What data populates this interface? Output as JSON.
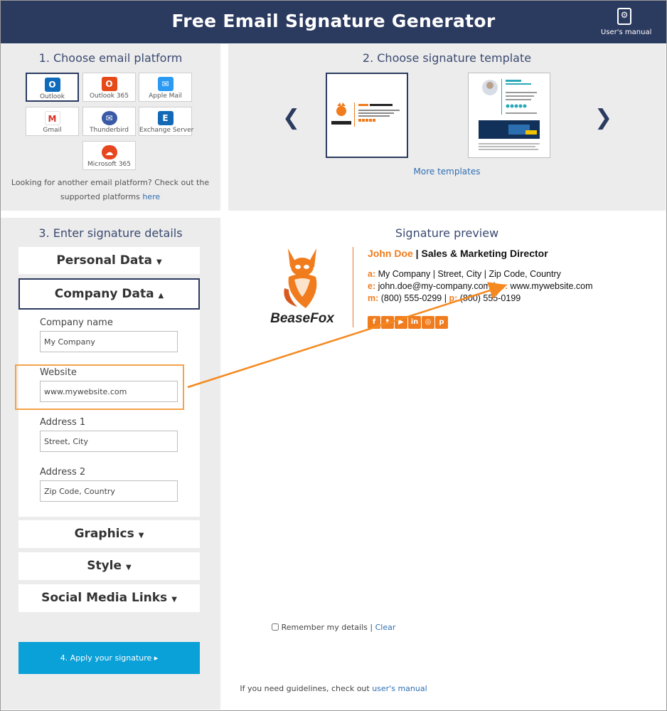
{
  "header": {
    "title": "Free Email Signature Generator",
    "manual_label": "User's manual"
  },
  "step1": {
    "title": "1. Choose email platform",
    "platforms": [
      {
        "label": "Outlook",
        "icon": "outlook-icon",
        "glyph": "O"
      },
      {
        "label": "Outlook 365",
        "icon": "outlook-365-icon",
        "glyph": "O"
      },
      {
        "label": "Apple Mail",
        "icon": "apple-mail-icon",
        "glyph": "✉"
      },
      {
        "label": "Gmail",
        "icon": "gmail-icon",
        "glyph": "M"
      },
      {
        "label": "Thunderbird",
        "icon": "thunderbird-icon",
        "glyph": "✉"
      },
      {
        "label": "Exchange Server",
        "icon": "exchange-icon",
        "glyph": "E"
      },
      {
        "label": "Microsoft 365",
        "icon": "microsoft-365-icon",
        "glyph": "☁"
      }
    ],
    "note": "Looking for another email platform? Check out the supported platforms",
    "note_link": "here"
  },
  "step2": {
    "title": "2. Choose signature template",
    "more_templates": "More templates",
    "prev_glyph": "❮",
    "next_glyph": "❯"
  },
  "step3": {
    "title": "3. Enter signature details",
    "sections": {
      "personal": "Personal Data",
      "company": "Company Data",
      "graphics": "Graphics",
      "style": "Style",
      "social": "Social Media Links"
    },
    "fields": {
      "company_name": {
        "label": "Company name",
        "value": "My Company"
      },
      "website": {
        "label": "Website",
        "value": "www.mywebsite.com"
      },
      "address1": {
        "label": "Address 1",
        "value": "Street, City"
      },
      "address2": {
        "label": "Address 2",
        "value": "Zip Code, Country"
      }
    },
    "remember": "Remember my details |",
    "clear": "Clear",
    "apply": "4. Apply your signature ▸",
    "guidelines": "If you need guidelines, check out",
    "guidelines_link": "user's manual"
  },
  "preview": {
    "title": "Signature preview",
    "brand": "BeaseFox",
    "name": "John Doe",
    "separator": " | ",
    "job_title": "Sales & Marketing Director",
    "address_label": "a:",
    "address": "My Company | Street, City | Zip Code, Country",
    "email_label": "e:",
    "email": "john.doe@my-company.com",
    "website_label": "w:",
    "website": "www.mywebsite.com",
    "mobile_label": "m:",
    "mobile": "(800) 555-0299",
    "phone_label": "p:",
    "phone": "(800) 555-0199",
    "socials": [
      {
        "name": "facebook-icon",
        "glyph": "f"
      },
      {
        "name": "twitter-icon",
        "glyph": "t"
      },
      {
        "name": "youtube-icon",
        "glyph": "▶"
      },
      {
        "name": "linkedin-icon",
        "glyph": "in"
      },
      {
        "name": "instagram-icon",
        "glyph": "◎"
      },
      {
        "name": "pinterest-icon",
        "glyph": "p"
      }
    ]
  },
  "colors": {
    "header": "#2b3a5f",
    "accent": "#f07c1e",
    "apply": "#0aa0d8"
  }
}
